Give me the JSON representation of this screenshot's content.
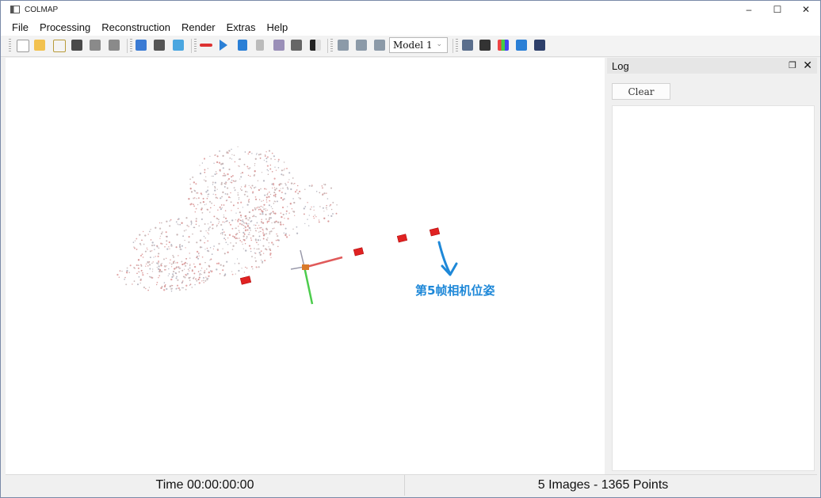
{
  "window": {
    "title": "COLMAP",
    "controls": {
      "minimize": "–",
      "maximize": "☐",
      "close": "✕"
    }
  },
  "menu": [
    "File",
    "Processing",
    "Reconstruction",
    "Render",
    "Extras",
    "Help"
  ],
  "toolbar": {
    "model_select": {
      "value": "Model 1"
    },
    "icons": [
      "new-project-icon",
      "open-project-icon",
      "edit-project-icon",
      "save-project-icon",
      "import-model-icon",
      "export-model-icon",
      "feature-extraction-icon",
      "feature-matching-icon",
      "database-management-icon",
      "automatic-reconstruction-icon",
      "start-reconstruction-icon",
      "step-reconstruction-icon",
      "pause-reconstruction-icon",
      "reset-reconstruction-icon",
      "bundle-adjustment-icon",
      "dense-reconstruction-icon",
      "render-options-icon",
      "reset-view-icon",
      "camera-pose-icon",
      "log-icon",
      "match-matrix-icon",
      "model-stats-icon",
      "screenshot-icon",
      "save-grab-icon"
    ]
  },
  "viewport": {
    "annotation": "第5帧相机位姿",
    "colors": {
      "annotation": "#1e88d8",
      "x_axis": "#e05a5a",
      "y_axis": "#4ccc4c",
      "camera": "#e02222"
    }
  },
  "log": {
    "title": "Log",
    "clear_label": "Clear"
  },
  "status": {
    "time": "Time 00:00:00:00",
    "summary": "5 Images - 1365 Points"
  }
}
